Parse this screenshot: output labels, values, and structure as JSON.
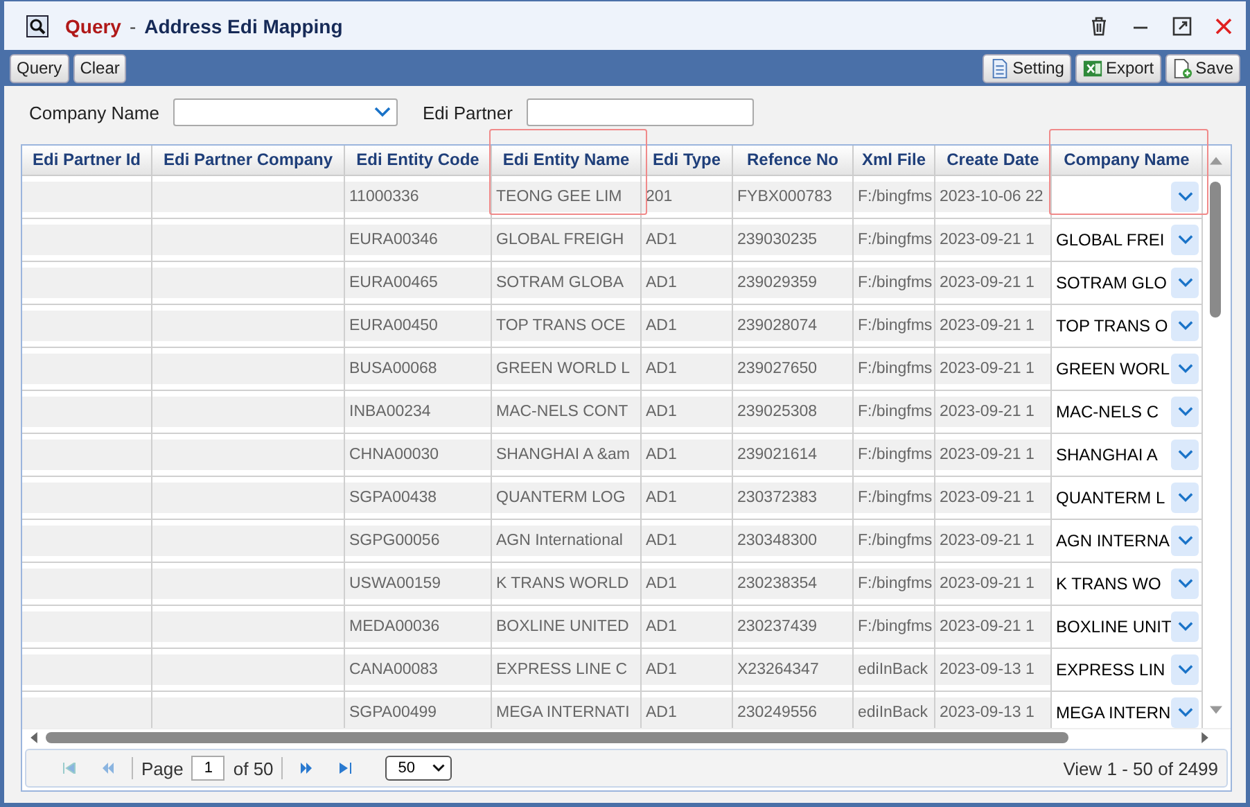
{
  "window": {
    "title_prefix": "Query",
    "separator": "-",
    "title": "Address Edi Mapping"
  },
  "toolbar": {
    "left": [
      {
        "label": "Query"
      },
      {
        "label": "Clear"
      }
    ],
    "right": [
      {
        "label": "Setting",
        "kind": "setting"
      },
      {
        "label": "Export",
        "kind": "export"
      },
      {
        "label": "Save",
        "kind": "save"
      }
    ]
  },
  "filters": [
    {
      "label": "Company Name",
      "kind": "select"
    },
    {
      "label": "Edi Partner",
      "kind": "text"
    }
  ],
  "table": {
    "columns": [
      {
        "label": "Edi Partner Id",
        "highlighted": false
      },
      {
        "label": "Edi Partner Company",
        "highlighted": false
      },
      {
        "label": "Edi Entity Code",
        "highlighted": false
      },
      {
        "label": "Edi Entity Name",
        "highlighted": true
      },
      {
        "label": "Edi Type",
        "highlighted": false
      },
      {
        "label": "Refence No",
        "highlighted": false
      },
      {
        "label": "Xml File",
        "highlighted": false
      },
      {
        "label": "Create Date",
        "highlighted": false
      },
      {
        "label": "Company Name",
        "highlighted": true
      }
    ],
    "rows": [
      {
        "cells": [
          "",
          "",
          "11000336",
          "TEONG GEE LIM",
          "201",
          "FYBX000783",
          "F:/bingfms",
          "2023-10-06 22"
        ]
      },
      {
        "cells": [
          "",
          "",
          "EURA00346",
          "GLOBAL FREIGH",
          "AD1",
          "239030235",
          "F:/bingfms",
          "2023-09-21 1"
        ],
        "company": "GLOBAL FREI"
      },
      {
        "cells": [
          "",
          "",
          "EURA00465",
          "SOTRAM GLOBA",
          "AD1",
          "239029359",
          "F:/bingfms",
          "2023-09-21 1"
        ],
        "company": "SOTRAM GLO"
      },
      {
        "cells": [
          "",
          "",
          "EURA00450",
          "TOP TRANS OCE",
          "AD1",
          "239028074",
          "F:/bingfms",
          "2023-09-21 1"
        ],
        "company": "TOP TRANS O"
      },
      {
        "cells": [
          "",
          "",
          "BUSA00068",
          "GREEN WORLD L",
          "AD1",
          "239027650",
          "F:/bingfms",
          "2023-09-21 1"
        ],
        "company": "GREEN WORL"
      },
      {
        "cells": [
          "",
          "",
          "INBA00234",
          "MAC-NELS CONT",
          "AD1",
          "239025308",
          "F:/bingfms",
          "2023-09-21 1"
        ],
        "company": "MAC-NELS C"
      },
      {
        "cells": [
          "",
          "",
          "CHNA00030",
          "SHANGHAI A &am",
          "AD1",
          "239021614",
          "F:/bingfms",
          "2023-09-21 1"
        ],
        "company": "SHANGHAI A"
      },
      {
        "cells": [
          "",
          "",
          "SGPA00438",
          "QUANTERM LOG",
          "AD1",
          "230372383",
          "F:/bingfms",
          "2023-09-21 1"
        ],
        "company": "QUANTERM L"
      },
      {
        "cells": [
          "",
          "",
          "SGPG00056",
          "AGN International",
          "AD1",
          "230348300",
          "F:/bingfms",
          "2023-09-21 1"
        ],
        "company": "AGN INTERNA"
      },
      {
        "cells": [
          "",
          "",
          "USWA00159",
          "K TRANS WORLD",
          "AD1",
          "230238354",
          "F:/bingfms",
          "2023-09-21 1"
        ],
        "company": "K TRANS WO"
      },
      {
        "cells": [
          "",
          "",
          "MEDA00036",
          "BOXLINE UNITED",
          "AD1",
          "230237439",
          "F:/bingfms",
          "2023-09-21 1"
        ],
        "company": "BOXLINE UNIT"
      },
      {
        "cells": [
          "",
          "",
          "CANA00083",
          "EXPRESS LINE C",
          "AD1",
          "X23264347",
          "ediInBack",
          "2023-09-13 1"
        ],
        "company": "EXPRESS LIN"
      },
      {
        "cells": [
          "",
          "",
          "SGPA00499",
          "MEGA INTERNATI",
          "AD1",
          "230249556",
          "ediInBack",
          "2023-09-13 1"
        ],
        "company": "MEGA INTERN"
      }
    ]
  },
  "pager": {
    "page_label": "Page",
    "page": "1",
    "of": "of 50",
    "page_size": "50",
    "view": "View 1 - 50 of 2499"
  }
}
